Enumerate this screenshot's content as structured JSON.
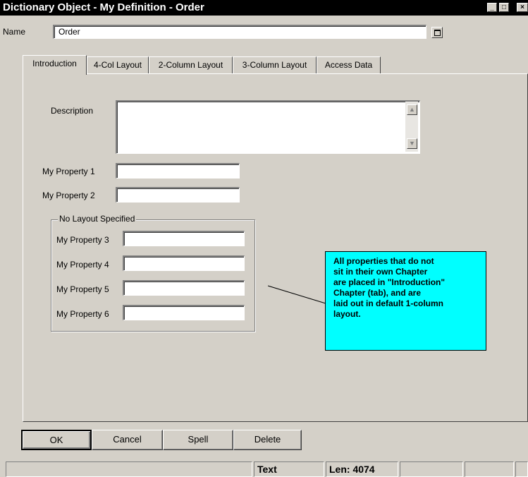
{
  "window": {
    "title": "Dictionary Object - My Definition - Order",
    "minimize_glyph": "_",
    "maximize_glyph": "□",
    "close_glyph": "×"
  },
  "name_field": {
    "label": "Name",
    "value": "Order",
    "button_icon": "maximize-icon"
  },
  "tabs": [
    {
      "label": "Introduction",
      "active": true
    },
    {
      "label": "4-Col Layout",
      "active": false
    },
    {
      "label": "2-Column Layout",
      "active": false
    },
    {
      "label": "3-Column Layout",
      "active": false
    },
    {
      "label": "Access Data",
      "active": false
    }
  ],
  "form": {
    "description_label": "Description",
    "description_value": "",
    "property1_label": "My Property 1",
    "property2_label": "My Property 2",
    "group_title": "No Layout Specified",
    "property3_label": "My Property 3",
    "property4_label": "My Property 4",
    "property5_label": "My Property 5",
    "property6_label": "My Property 6"
  },
  "callout": {
    "text_lines": [
      "All properties that do not",
      "sit in their own Chapter",
      "are placed in \"Introduction\"",
      "Chapter (tab), and are",
      "laid out in default 1-column",
      "layout."
    ],
    "background": "#00ffff"
  },
  "buttons": {
    "ok": "OK",
    "cancel": "Cancel",
    "spell": "Spell",
    "delete": "Delete"
  },
  "statusbar": {
    "type": "Text",
    "length": "Len: 4074"
  },
  "colors": {
    "face": "#d4d0c8",
    "titlebar": "#000000"
  }
}
